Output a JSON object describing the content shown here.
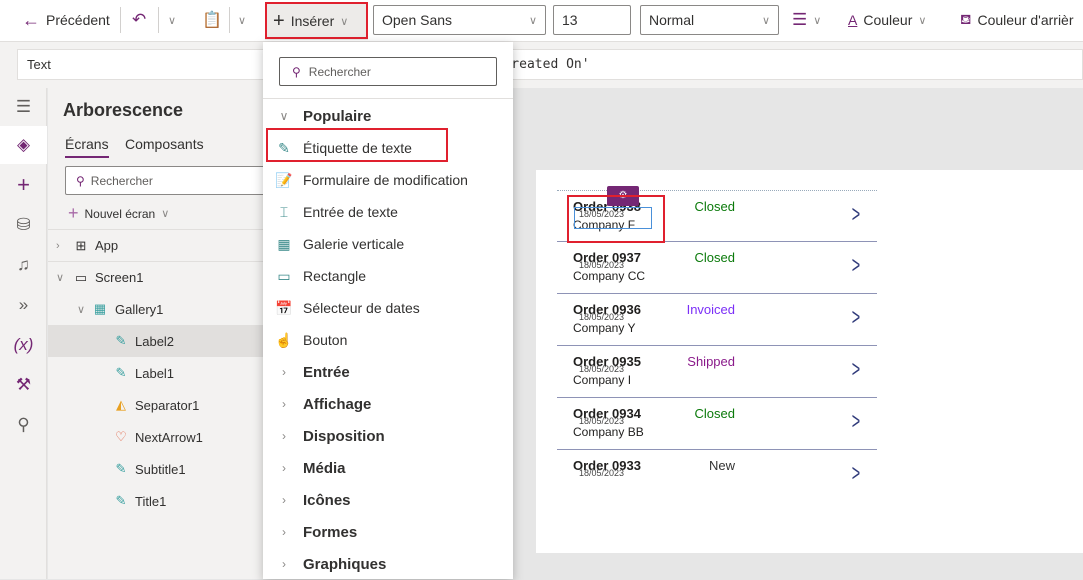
{
  "toolbar": {
    "back": "Précédent",
    "insert": "Insérer",
    "font": "Open Sans",
    "size": "13",
    "weight": "Normal",
    "color": "Couleur",
    "fill": "Couleur d'arrièr"
  },
  "formula": {
    "property": "Text",
    "code": "m.'Created On'"
  },
  "rail": [
    "menu-icon",
    "tree-icon",
    "plus-icon",
    "data-icon",
    "media-icon",
    "power-automate-icon",
    "variables-icon",
    "tools-icon",
    "search-icon"
  ],
  "tree": {
    "title": "Arborescence",
    "tabs": [
      "Écrans",
      "Composants"
    ],
    "search": "Rechercher",
    "new_screen": "Nouvel écran",
    "items": [
      "App",
      "Screen1",
      "Gallery1",
      "Label2",
      "Label1",
      "Separator1",
      "NextArrow1",
      "Subtitle1",
      "Title1"
    ]
  },
  "menu": {
    "search": "Rechercher",
    "popular": "Populaire",
    "items": [
      "Étiquette de texte",
      "Formulaire de modification",
      "Entrée de texte",
      "Galerie verticale",
      "Rectangle",
      "Sélecteur de dates",
      "Bouton"
    ],
    "categories": [
      "Entrée",
      "Affichage",
      "Disposition",
      "Média",
      "Icônes",
      "Formes",
      "Graphiques"
    ]
  },
  "gallery": [
    {
      "order": "Order 0938",
      "date": "18/05/2023",
      "company": "Company F",
      "status": "Closed",
      "color": "#0b7a0b"
    },
    {
      "order": "Order 0937",
      "date": "18/05/2023",
      "company": "Company CC",
      "status": "Closed",
      "color": "#0b7a0b"
    },
    {
      "order": "Order 0936",
      "date": "18/05/2023",
      "company": "Company Y",
      "status": "Invoiced",
      "color": "#7b2ff7"
    },
    {
      "order": "Order 0935",
      "date": "18/05/2023",
      "company": "Company I",
      "status": "Shipped",
      "color": "#8a1a8a"
    },
    {
      "order": "Order 0934",
      "date": "18/05/2023",
      "company": "Company BB",
      "status": "Closed",
      "color": "#0b7a0b"
    },
    {
      "order": "Order 0933",
      "date": "18/05/2023",
      "company": "",
      "status": "New",
      "color": "#333333"
    }
  ],
  "accent": "#742774"
}
